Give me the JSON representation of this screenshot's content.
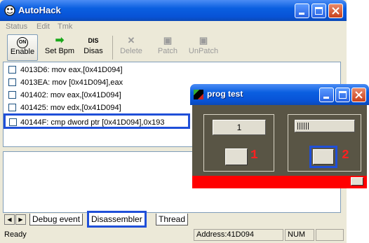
{
  "main_window": {
    "title": "AutoHack",
    "menu": [
      "Status",
      "Edit",
      "Tmk"
    ],
    "toolbar": [
      {
        "icon": "on-icon",
        "icon_text": "ON",
        "label": "Enable",
        "enabled": true
      },
      {
        "icon": "green-arrow-icon",
        "icon_text": "➡",
        "label": "Set Bpm",
        "enabled": true
      },
      {
        "icon": "dis-icon",
        "icon_text": "DIS",
        "label": "Disas",
        "enabled": true
      },
      {
        "icon": "x-icon",
        "icon_text": "✕",
        "label": "Delete",
        "enabled": false
      },
      {
        "icon": "patch-icon",
        "icon_text": "▣",
        "label": "Patch",
        "enabled": false
      },
      {
        "icon": "unpatch-icon",
        "icon_text": "▣",
        "label": "UnPatch",
        "enabled": false
      }
    ],
    "rows": [
      "4013D6:  mov eax,[0x41D094]",
      "4013EA:  mov [0x41D094],eax",
      "401402:  mov eax,[0x41D094]",
      "401425:  mov edx,[0x41D094]",
      "40144F:  cmp dword ptr [0x41D094],0x193"
    ],
    "tabs": [
      "Debug event",
      "Disassembler",
      "Thread"
    ],
    "status": {
      "ready": "Ready",
      "address": "Address:41D094",
      "num": "NUM"
    }
  },
  "prog_window": {
    "title": "prog test",
    "value": "1",
    "marker_1": "1",
    "marker_2": "2",
    "colors": {
      "body": "#595545",
      "red_bar": "#ff0000"
    }
  },
  "highlight_color": "#1f4fd8"
}
